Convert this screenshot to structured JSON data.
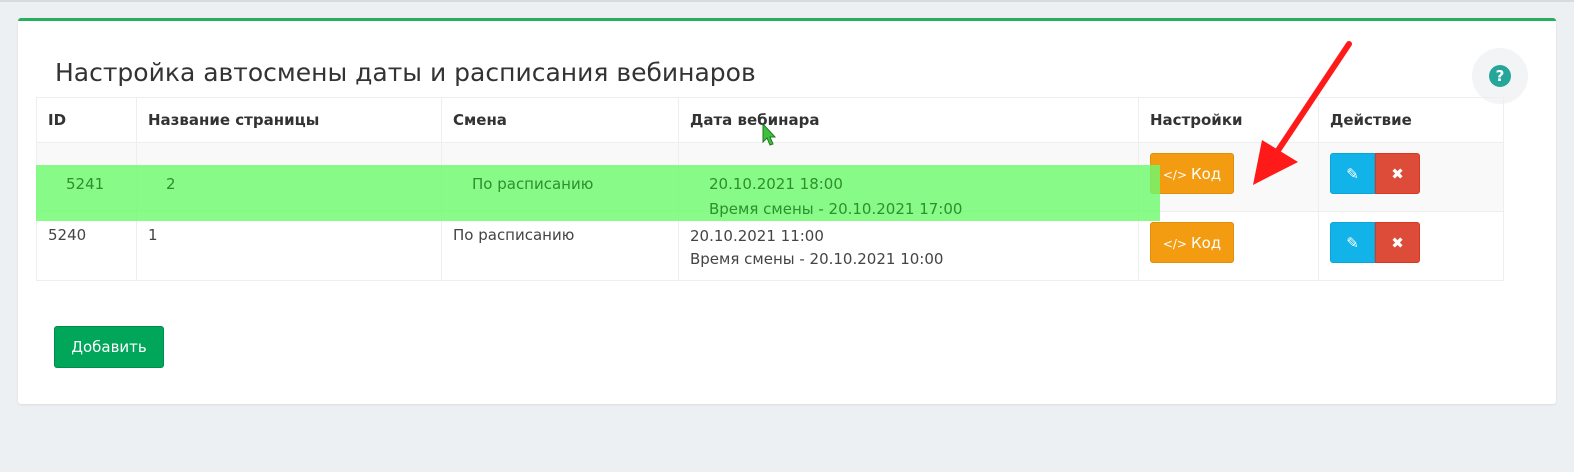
{
  "page": {
    "title": "Настройка автосмены даты и расписания вебинаров",
    "help_icon": "question-circle-icon",
    "add_button": "Добавить"
  },
  "table": {
    "headers": [
      "ID",
      "Название страницы",
      "Смена",
      "Дата вебинара",
      "Настройки",
      "Действие"
    ],
    "rows": [
      {
        "id": "5241",
        "name": "2",
        "shift": "По расписанию",
        "date": "20.10.2021 18:00",
        "shift_time": "Время смены - 20.10.2021 17:00",
        "code_label": "Код",
        "code_icon": "code-icon",
        "highlighted": true
      },
      {
        "id": "5240",
        "name": "1",
        "shift": "По расписанию",
        "date": "20.10.2021 11:00",
        "shift_time": "Время смены - 20.10.2021 10:00",
        "code_label": "Код",
        "code_icon": "code-icon",
        "highlighted": false
      }
    ],
    "edit_icon": "pencil-icon",
    "delete_icon": "times-icon"
  },
  "colors": {
    "primary_green": "#00a65a",
    "code_orange": "#f39c12",
    "edit_blue": "#12b3e8",
    "delete_red": "#dd4b39",
    "highlight_green": "#6efa6e",
    "annotation_arrow": "#ff1a1a"
  }
}
